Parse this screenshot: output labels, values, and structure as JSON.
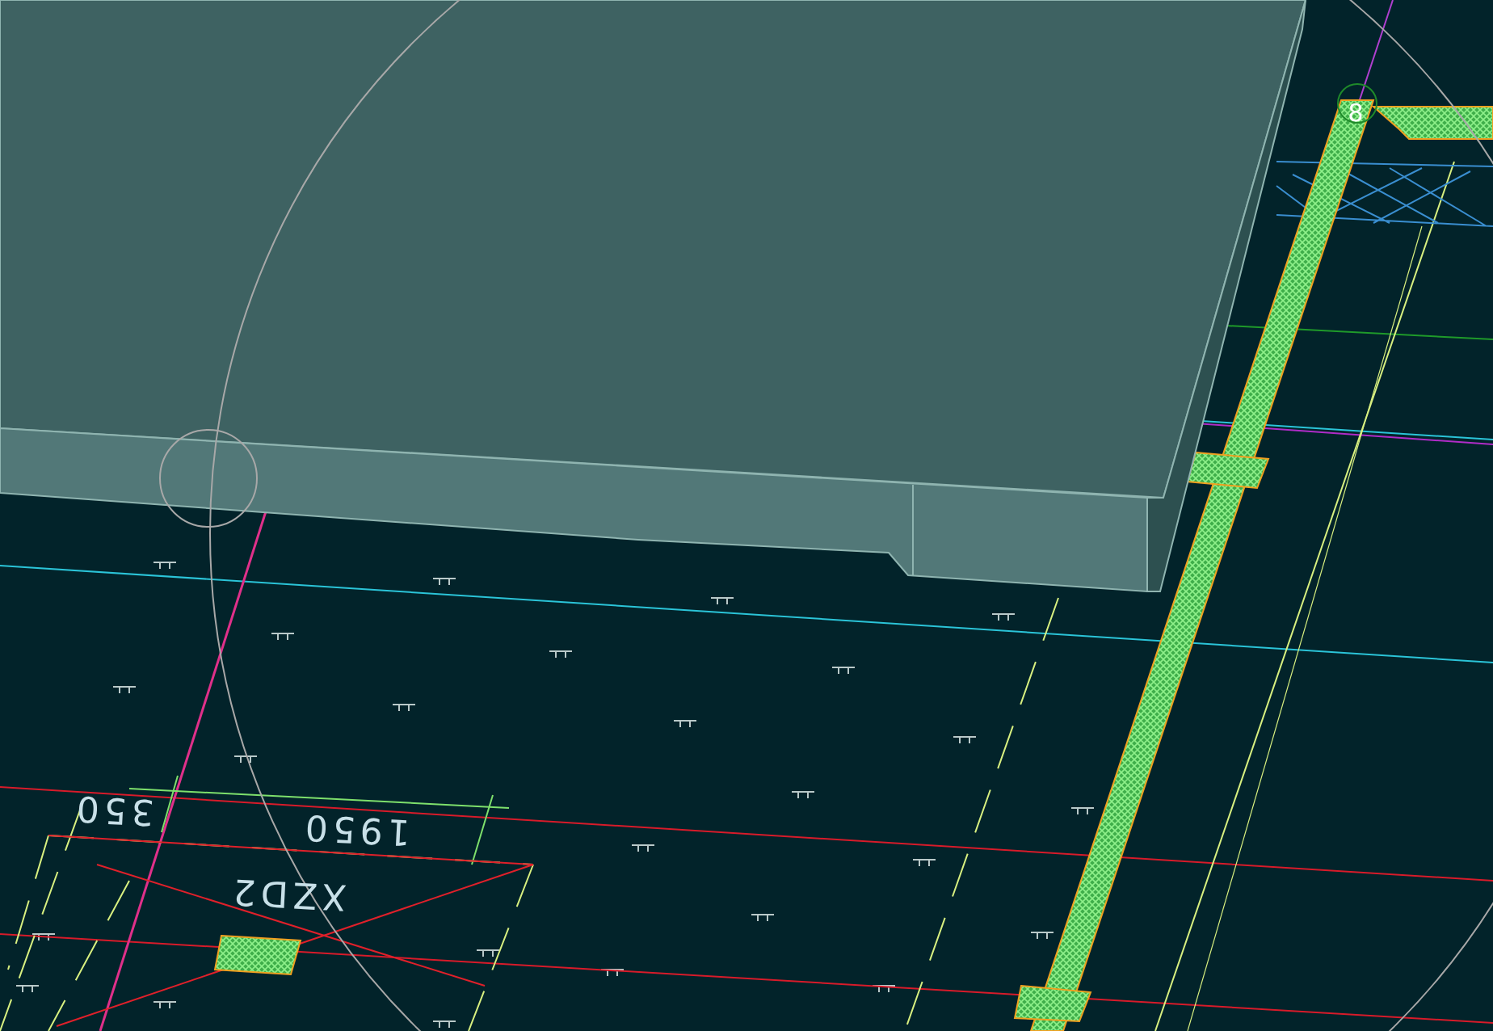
{
  "drawing": {
    "labels": [
      {
        "kind": "dimension",
        "text": "350"
      },
      {
        "kind": "dimension",
        "text": "1950"
      },
      {
        "kind": "tag",
        "text": "XZD2"
      },
      {
        "kind": "node",
        "text": "8"
      }
    ]
  }
}
